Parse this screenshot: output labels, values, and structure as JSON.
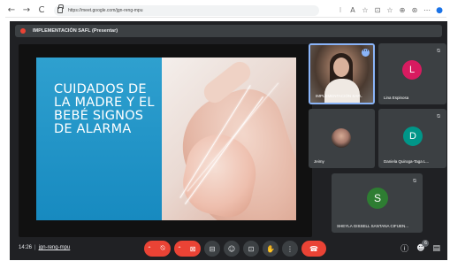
{
  "browser": {
    "back": "←",
    "forward": "→",
    "reload": "C",
    "url": "https://meet.google.com/jgn-reng-mpu",
    "extensions": [
      "⁝",
      "A",
      "☆",
      "⊡",
      "☆",
      "⊕",
      "⊛",
      "⋯",
      "●"
    ]
  },
  "meet": {
    "presentation_title": "IMPLEMENTACIÓN SAFL (Presentar)",
    "slide": {
      "lines": [
        "CUIDADOS DE",
        "LA MADRE Y EL",
        "BEBÉ SIGNOS",
        "DE ALARMA"
      ]
    },
    "participants": {
      "self": {
        "name": "IMPLEMENTACIÓN SAFL",
        "more": "⋯"
      },
      "lina": {
        "name": "Lina Espinosa",
        "initial": "L",
        "color": "#d81b60"
      },
      "jeimy": {
        "name": "Jeimy"
      },
      "daniela": {
        "name": "Daniela Quiroga-Taga L...",
        "initial": "D",
        "color": "#009688"
      },
      "sheyla": {
        "name": "SHEYLA GISSELL SANTANA CIFUEN...",
        "initial": "S",
        "color": "#2e7d32"
      }
    },
    "bottom": {
      "time": "14:26",
      "separator": "|",
      "meeting_code": "jgn-reng-mpu",
      "participant_count": "6"
    },
    "colors": {
      "background": "#202124",
      "tile": "#3c4043",
      "danger": "#ea4335",
      "accent": "#8ab4f8",
      "slide_blue": "#2fa0cf"
    }
  }
}
